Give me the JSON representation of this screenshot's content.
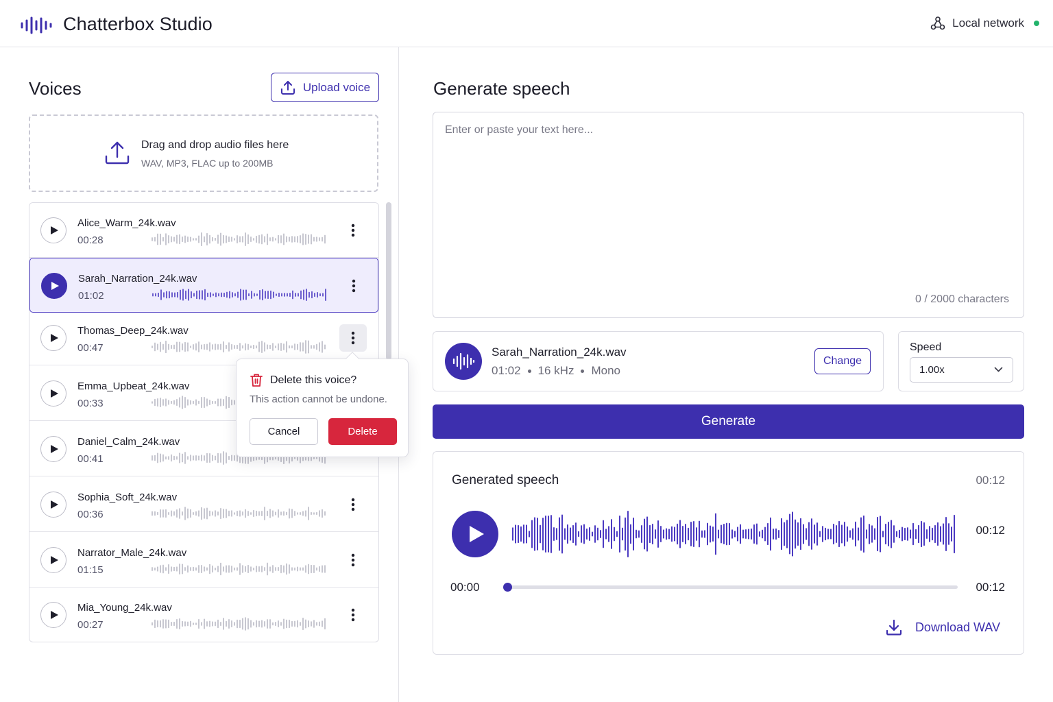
{
  "app": {
    "title": "Chatterbox Studio",
    "network_status": "Local network",
    "status_color": "#22b36b",
    "accent_color": "#3d2fae",
    "danger_color": "#d7263d"
  },
  "voices_panel": {
    "title": "Voices",
    "upload_label": "Upload voice",
    "dropzone": {
      "main": "Drag and drop audio files here",
      "sub": "WAV, MP3, FLAC up to 200MB"
    },
    "items": [
      {
        "name": "Alice_Warm_24k.wav",
        "duration": "00:28"
      },
      {
        "name": "Sarah_Narration_24k.wav",
        "duration": "01:02"
      },
      {
        "name": "Thomas_Deep_24k.wav",
        "duration": "00:47"
      },
      {
        "name": "Emma_Upbeat_24k.wav",
        "duration": "00:33"
      },
      {
        "name": "Daniel_Calm_24k.wav",
        "duration": "00:41"
      },
      {
        "name": "Sophia_Soft_24k.wav",
        "duration": "00:36"
      },
      {
        "name": "Narrator_Male_24k.wav",
        "duration": "01:15"
      },
      {
        "name": "Mia_Young_24k.wav",
        "duration": "00:27"
      }
    ],
    "selected_index": 1
  },
  "delete_popover": {
    "title": "Delete this voice?",
    "subtitle": "This action cannot be undone.",
    "cancel": "Cancel",
    "delete": "Delete"
  },
  "generate_panel": {
    "title": "Generate speech",
    "placeholder": "Enter or paste your text here...",
    "text_value": "",
    "char_count": "0 / 2000 characters",
    "selected_voice": {
      "name": "Sarah_Narration_24k.wav",
      "duration": "01:02",
      "sample_rate": "16 kHz",
      "channels": "Mono",
      "change_label": "Change"
    },
    "speed": {
      "label": "Speed",
      "value": "1.00x"
    },
    "generate_label": "Generate"
  },
  "result": {
    "title": "Generated speech",
    "duration": "00:12",
    "wave_time": "00:12",
    "current_time": "00:00",
    "end_time": "00:12",
    "progress": 0,
    "download_label": "Download WAV"
  }
}
